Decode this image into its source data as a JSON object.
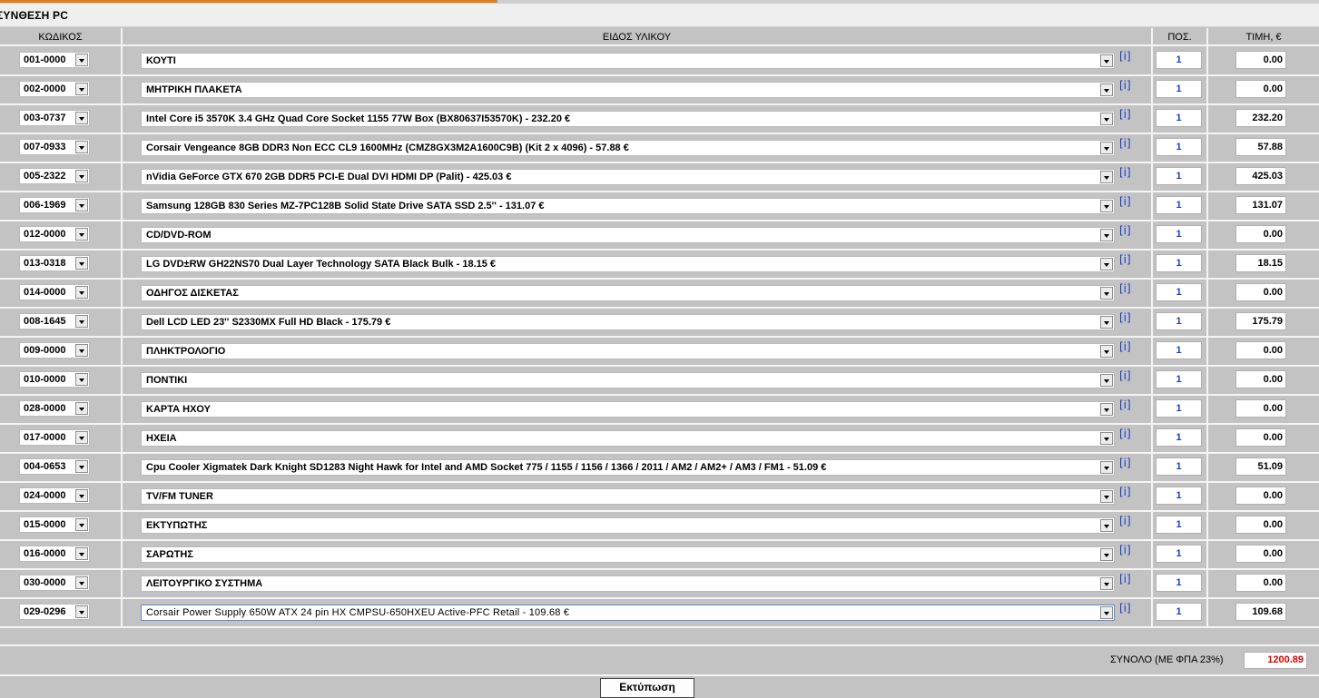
{
  "page": {
    "title": "ΣΥΝΘΕΣΗ PC"
  },
  "headers": {
    "code": "ΚΩΔΙΚΟΣ",
    "item": "ΕΙΔΟΣ ΥΛΙΚΟΥ",
    "qty": "ΠΟΣ.",
    "price": "ΤΙΜΗ, €"
  },
  "info_label": "[i]",
  "rows": [
    {
      "code": "001-0000",
      "item": "ΚΟΥΤΙ",
      "qty": "1",
      "price": "0.00"
    },
    {
      "code": "002-0000",
      "item": "ΜΗΤΡΙΚΗ ΠΛΑΚΕΤΑ",
      "qty": "1",
      "price": "0.00"
    },
    {
      "code": "003-0737",
      "item": "Intel Core i5 3570K 3.4 GHz Quad Core Socket 1155 77W Box (BX80637I53570K) - 232.20 €",
      "qty": "1",
      "price": "232.20"
    },
    {
      "code": "007-0933",
      "item": "Corsair Vengeance 8GB DDR3 Non ECC CL9 1600MHz (CMZ8GX3M2A1600C9B) (Kit 2 x 4096) - 57.88 €",
      "qty": "1",
      "price": "57.88"
    },
    {
      "code": "005-2322",
      "item": "nVidia GeForce GTX 670 2GB DDR5 PCI-E Dual DVI HDMI DP (Palit) - 425.03 €",
      "qty": "1",
      "price": "425.03"
    },
    {
      "code": "006-1969",
      "item": "Samsung 128GB 830 Series MZ-7PC128B Solid State Drive SATA SSD 2.5'' - 131.07 €",
      "qty": "1",
      "price": "131.07"
    },
    {
      "code": "012-0000",
      "item": "CD/DVD-ROM",
      "qty": "1",
      "price": "0.00"
    },
    {
      "code": "013-0318",
      "item": "LG DVD±RW GH22NS70 Dual Layer Technology SATA Black Bulk - 18.15 €",
      "qty": "1",
      "price": "18.15"
    },
    {
      "code": "014-0000",
      "item": "ΟΔΗΓΟΣ ΔΙΣΚΕΤΑΣ",
      "qty": "1",
      "price": "0.00"
    },
    {
      "code": "008-1645",
      "item": "Dell LCD LED 23'' S2330MX Full HD Black - 175.79 €",
      "qty": "1",
      "price": "175.79"
    },
    {
      "code": "009-0000",
      "item": "ΠΛΗΚΤΡΟΛΟΓΙΟ",
      "qty": "1",
      "price": "0.00"
    },
    {
      "code": "010-0000",
      "item": "ΠΟΝΤΙΚΙ",
      "qty": "1",
      "price": "0.00"
    },
    {
      "code": "028-0000",
      "item": "ΚΑΡΤΑ ΗΧΟΥ",
      "qty": "1",
      "price": "0.00"
    },
    {
      "code": "017-0000",
      "item": "ΗΧΕΙΑ",
      "qty": "1",
      "price": "0.00"
    },
    {
      "code": "004-0653",
      "item": "Cpu Cooler Xigmatek Dark Knight SD1283 Night Hawk for Intel and AMD Socket 775 / 1155 / 1156 / 1366 / 2011 / AM2 / AM2+ / AM3 / FM1 - 51.09 €",
      "qty": "1",
      "price": "51.09"
    },
    {
      "code": "024-0000",
      "item": "TV/FM TUNER",
      "qty": "1",
      "price": "0.00"
    },
    {
      "code": "015-0000",
      "item": "ΕΚΤΥΠΩΤΗΣ",
      "qty": "1",
      "price": "0.00"
    },
    {
      "code": "016-0000",
      "item": "ΣΑΡΩΤΗΣ",
      "qty": "1",
      "price": "0.00"
    },
    {
      "code": "030-0000",
      "item": "ΛΕΙΤΟΥΡΓΙΚΟ ΣΥΣΤΗΜΑ",
      "qty": "1",
      "price": "0.00"
    },
    {
      "code": "029-0296",
      "item": "Corsair Power Supply 650W ATX 24 pin HX CMPSU-650HXEU Active-PFC Retail - 109.68 €",
      "qty": "1",
      "price": "109.68"
    }
  ],
  "selected_row": 19,
  "total": {
    "label": "ΣΥΝΟΛΟ (ΜΕ ΦΠΑ 23%)",
    "value": "1200.89"
  },
  "print_button": "Εκτύπωση",
  "colors": {
    "accent_tab": "#e07b1e",
    "total_value": "#e00000",
    "qty_text": "#1a3ec8",
    "info_link": "#1a3ec8"
  }
}
